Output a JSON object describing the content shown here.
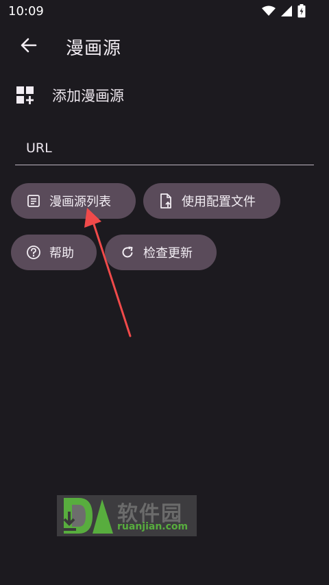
{
  "status_bar": {
    "time": "10:09",
    "icons": [
      "wifi-icon",
      "signal-icon",
      "battery-charging-icon"
    ]
  },
  "app_bar": {
    "back_icon": "arrow-back-icon",
    "title": "漫画源"
  },
  "add_source": {
    "icon": "add-grid-icon",
    "label": "添加漫画源"
  },
  "url_field": {
    "placeholder": "URL",
    "value": ""
  },
  "actions": {
    "source_list": {
      "label": "漫画源列表",
      "icon": "list-document-icon"
    },
    "use_config": {
      "label": "使用配置文件",
      "icon": "file-upload-icon"
    },
    "help": {
      "label": "帮助",
      "icon": "help-circle-icon"
    },
    "check_update": {
      "label": "检查更新",
      "icon": "refresh-icon"
    }
  },
  "watermark": {
    "title": "软件园",
    "subtitle": "ruanjian.com",
    "logo": "DA"
  },
  "colors": {
    "background": "#1c1a1f",
    "chip": "#5a4b5a",
    "annotation_arrow": "#f04a4a",
    "watermark_green": "#58ad3e"
  }
}
